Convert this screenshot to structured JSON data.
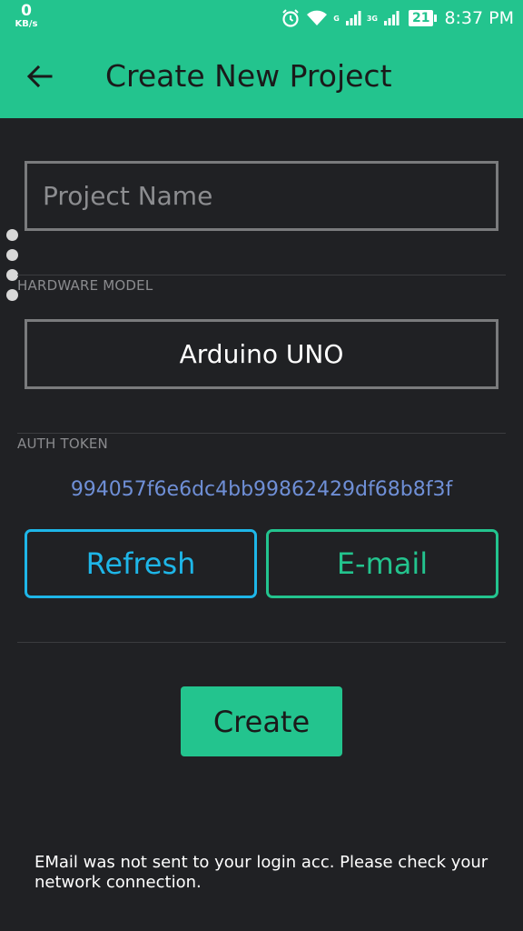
{
  "status_bar": {
    "speed_value": "0",
    "speed_unit": "KB/s",
    "network_tag_1": "G",
    "network_tag_2": "3G",
    "battery": "21",
    "time": "8:37 PM"
  },
  "app_bar": {
    "title": "Create New Project",
    "back_icon": "arrow-left-icon"
  },
  "form": {
    "project_name_placeholder": "Project Name",
    "project_name_value": "",
    "hardware_label": "HARDWARE MODEL",
    "hardware_value": "Arduino UNO",
    "auth_label": "AUTH TOKEN",
    "auth_token": "994057f6e6dc4bb99862429df68b8f3f"
  },
  "buttons": {
    "refresh": "Refresh",
    "email": "E-mail",
    "create": "Create"
  },
  "toast": "EMail was not sent to your login acc. Please check your network connection.",
  "colors": {
    "accent": "#23c48e",
    "refresh": "#1eb6e8",
    "background": "#202124",
    "token": "#6f8fd6"
  }
}
